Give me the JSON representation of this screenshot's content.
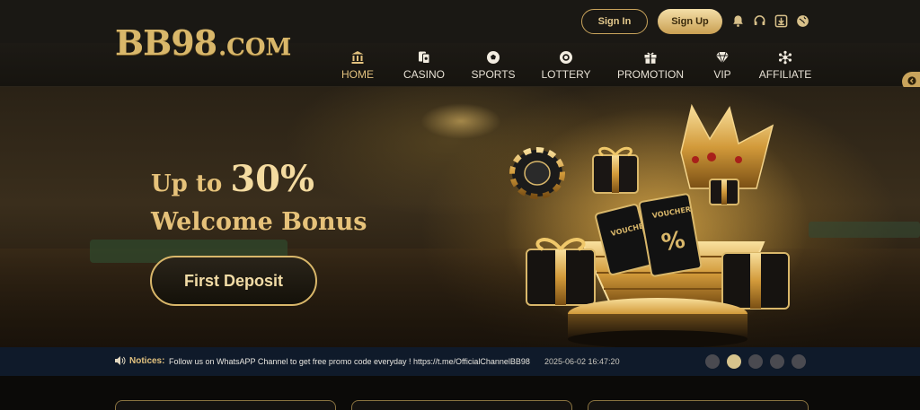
{
  "brand": {
    "logo_main": "BB98",
    "logo_domain": ".COM"
  },
  "auth": {
    "signin_label": "Sign In",
    "signup_label": "Sign Up"
  },
  "top_icons": [
    "bell-icon",
    "headset-icon",
    "download-icon",
    "globe-icon"
  ],
  "nav": {
    "items": [
      {
        "label": "HOME",
        "icon": "bank-icon",
        "active": true
      },
      {
        "label": "CASINO",
        "icon": "cards-icon"
      },
      {
        "label": "SPORTS",
        "icon": "soccer-ball-icon"
      },
      {
        "label": "LOTTERY",
        "icon": "lottery-ball-icon"
      },
      {
        "label": "PROMOTION",
        "icon": "gift-icon"
      },
      {
        "label": "VIP",
        "icon": "diamond-icon"
      },
      {
        "label": "AFFILIATE",
        "icon": "network-icon"
      }
    ]
  },
  "banner": {
    "line1_prefix": "Up to ",
    "line1_value": "30%",
    "line2": "Welcome Bonus",
    "cta_label": "First Deposit",
    "art_labels": {
      "voucher_1": "VOUCHER",
      "voucher_2": "VOUCHER",
      "percent": "%"
    },
    "slides_total": 5,
    "slide_active": 2
  },
  "notice": {
    "label": "Notices:",
    "text": "Follow us on WhatsAPP Channel to get free promo code everyday ! https://t.me/OfficialChannelBB98",
    "timestamp": "2025-06-02 16:47:20"
  },
  "colors": {
    "gold": "#d9b76a",
    "notice_bg": "#0f1a2a",
    "nav_bg": "#1a1814"
  }
}
